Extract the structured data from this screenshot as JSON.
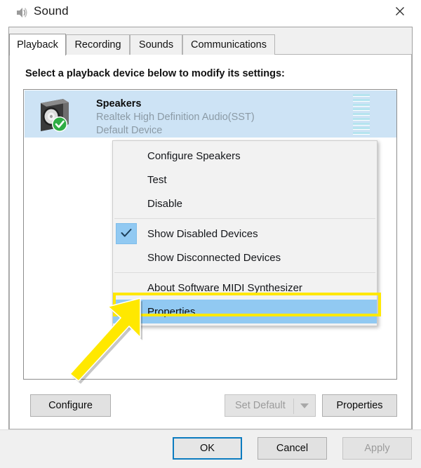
{
  "window": {
    "title": "Sound",
    "icon": "speaker-icon",
    "close_label": "✕"
  },
  "tabs": [
    {
      "label": "Playback",
      "selected": true
    },
    {
      "label": "Recording",
      "selected": false
    },
    {
      "label": "Sounds",
      "selected": false
    },
    {
      "label": "Communications",
      "selected": false
    }
  ],
  "page": {
    "instruction": "Select a playback device below to modify its settings:"
  },
  "devices": [
    {
      "name": "Speakers",
      "driver": "Realtek High Definition Audio(SST)",
      "status": "Default Device",
      "selected": true,
      "default_badge": "check-badge-icon",
      "volume_segments": 9
    }
  ],
  "context_menu": {
    "items": [
      {
        "label": "Configure Speakers",
        "checked": false,
        "highlighted": false,
        "separator_after": false
      },
      {
        "label": "Test",
        "checked": false,
        "highlighted": false,
        "separator_after": false
      },
      {
        "label": "Disable",
        "checked": false,
        "highlighted": false,
        "separator_after": true
      },
      {
        "label": "Show Disabled Devices",
        "checked": true,
        "highlighted": false,
        "separator_after": false
      },
      {
        "label": "Show Disconnected Devices",
        "checked": false,
        "highlighted": false,
        "separator_after": true
      },
      {
        "label": "About Software MIDI Synthesizer",
        "checked": false,
        "highlighted": false,
        "separator_after": false
      },
      {
        "label": "Properties",
        "checked": false,
        "highlighted": true,
        "separator_after": false
      }
    ]
  },
  "annotation": {
    "highlight_color": "#ffe800",
    "arrow_color": "#ffe800",
    "target": "Properties"
  },
  "action_buttons": {
    "configure": "Configure",
    "set_default": "Set Default",
    "properties": "Properties"
  },
  "footer_buttons": {
    "ok": "OK",
    "cancel": "Cancel",
    "apply": "Apply"
  },
  "colors": {
    "selection_blue": "#cde3f5",
    "menu_highlight": "#91c9f2",
    "default_focus": "#0d7cc0",
    "meter_green": "#b5e4ef",
    "badge_green": "#2fad44"
  }
}
